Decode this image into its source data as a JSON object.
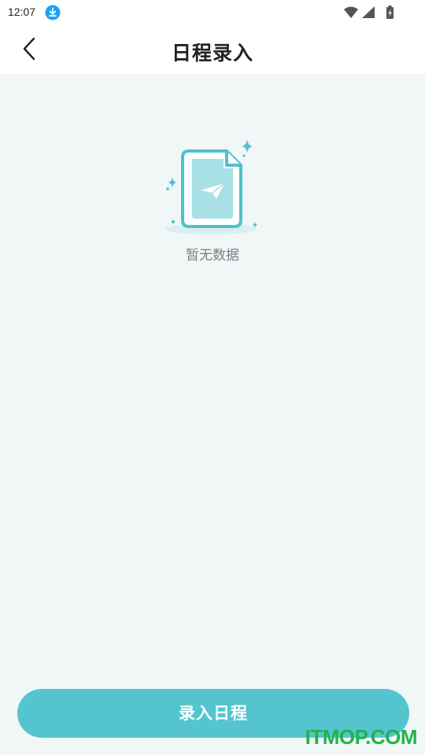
{
  "status_bar": {
    "time": "12:07",
    "icons": [
      "download-icon",
      "wifi-icon",
      "signal-icon",
      "battery-icon"
    ],
    "download_icon_color": "#1aa3f0"
  },
  "header": {
    "title": "日程录入",
    "back_icon": "chevron-left-icon"
  },
  "empty_state": {
    "icon": "empty-document-paper-plane-icon",
    "message": "暂无数据",
    "accent_color": "#4fc1cc"
  },
  "footer": {
    "button_label": "录入日程",
    "button_color": "#54c5cf"
  },
  "watermark": {
    "text": "ITMOP.COM",
    "color": "#22b24c"
  }
}
